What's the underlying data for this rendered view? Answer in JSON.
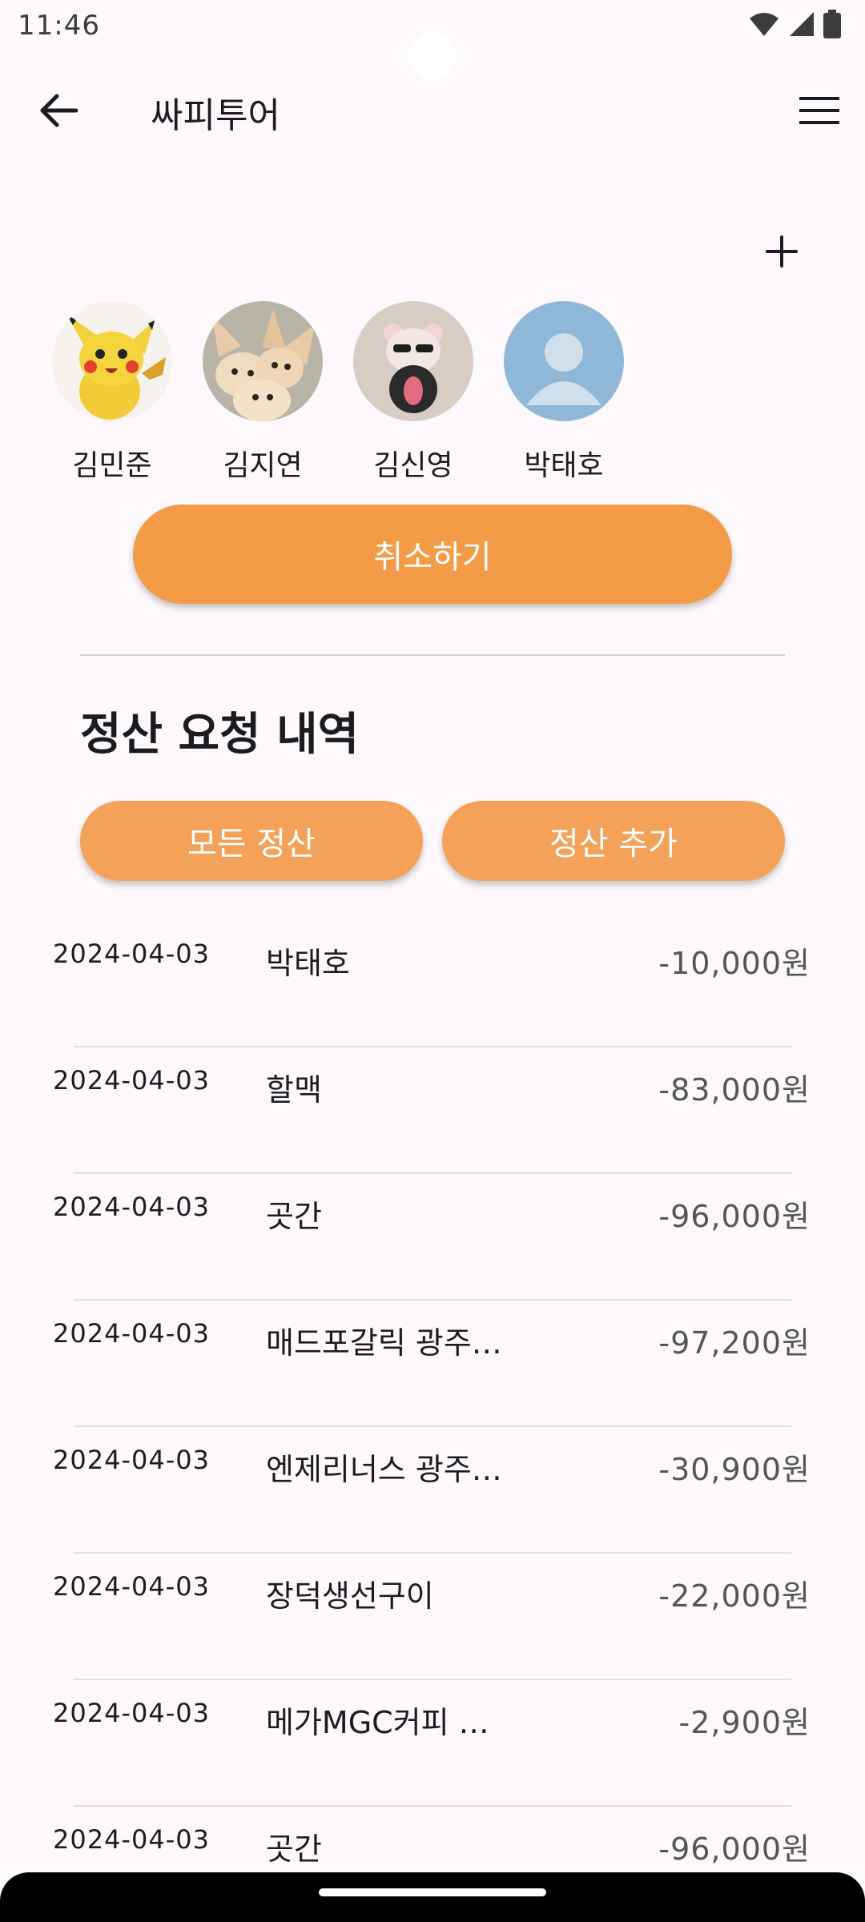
{
  "status_bar": {
    "time": "11:46"
  },
  "app_bar": {
    "title": "싸피투어"
  },
  "members": [
    {
      "name": "김민준"
    },
    {
      "name": "김지연"
    },
    {
      "name": "김신영"
    },
    {
      "name": "박태호"
    }
  ],
  "actions": {
    "cancel_label": "취소하기",
    "all_label": "모든 정산",
    "add_label": "정산 추가"
  },
  "section": {
    "title": "정산 요청 내역"
  },
  "settlements": [
    {
      "date": "2024-04-03",
      "title": "박태호",
      "amount": "-10,000원"
    },
    {
      "date": "2024-04-03",
      "title": "할맥",
      "amount": "-83,000원"
    },
    {
      "date": "2024-04-03",
      "title": "곳간",
      "amount": "-96,000원"
    },
    {
      "date": "2024-04-03",
      "title": "매드포갈릭 광주…",
      "amount": "-97,200원"
    },
    {
      "date": "2024-04-03",
      "title": "엔제리너스 광주…",
      "amount": "-30,900원"
    },
    {
      "date": "2024-04-03",
      "title": "장덕생선구이",
      "amount": "-22,000원"
    },
    {
      "date": "2024-04-03",
      "title": "메가MGC커피 …",
      "amount": "-2,900원"
    },
    {
      "date": "2024-04-03",
      "title": "곳간",
      "amount": "-96,000원"
    }
  ],
  "colors": {
    "accent": "#f49b48",
    "background": "#fdf8fb",
    "divider": "#e2dde4"
  },
  "icons": [
    "back-arrow-icon",
    "menu-icon",
    "plus-icon",
    "wifi-icon",
    "signal-icon",
    "battery-icon"
  ]
}
